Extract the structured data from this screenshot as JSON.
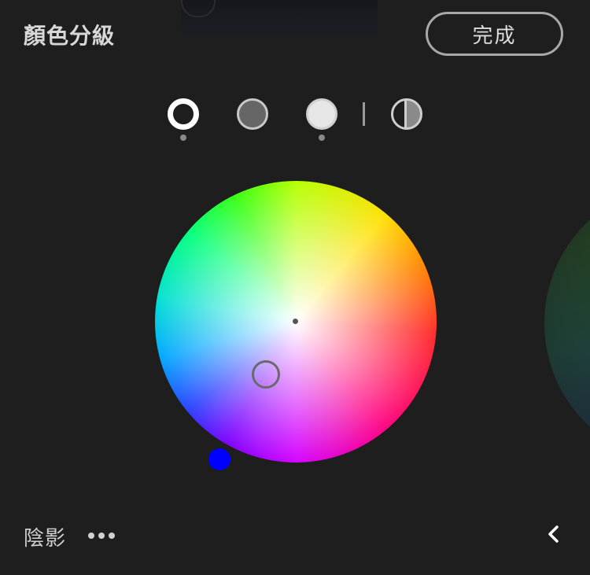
{
  "header": {
    "title": "顏色分級",
    "done_label": "完成"
  },
  "modes": {
    "items": [
      {
        "name": "shadows",
        "icon": "shadows-ring-icon",
        "selected": true
      },
      {
        "name": "midtones",
        "icon": "midtones-circle-icon",
        "selected": false
      },
      {
        "name": "highlights",
        "icon": "highlights-circle-icon",
        "selected": false
      },
      {
        "name": "global",
        "icon": "global-half-circle-icon",
        "selected": false
      }
    ]
  },
  "wheel": {
    "selected_color": "#0000ff"
  },
  "footer": {
    "label": "陰影",
    "more_icon": "more-dots-icon",
    "back_icon": "chevron-left-icon"
  }
}
